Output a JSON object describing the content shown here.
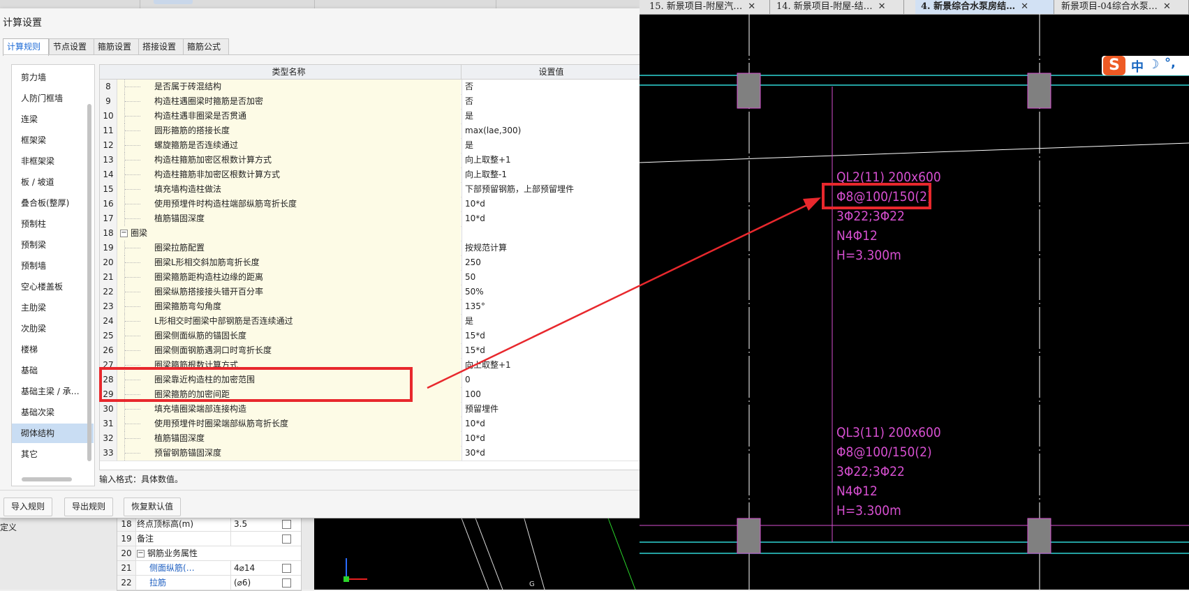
{
  "dialog": {
    "title": "计算设置",
    "tabs": [
      "计算规则",
      "节点设置",
      "箍筋设置",
      "搭接设置",
      "箍筋公式"
    ],
    "categories": [
      "剪力墙",
      "人防门框墙",
      "连梁",
      "框架梁",
      "非框架梁",
      "板 / 坡道",
      "叠合板(整厚)",
      "预制柱",
      "预制梁",
      "预制墙",
      "空心楼盖板",
      "主肋梁",
      "次肋梁",
      "楼梯",
      "基础",
      "基础主梁 / 承…",
      "基础次梁",
      "砌体结构",
      "其它"
    ],
    "selected_category": "砌体结构",
    "grid_headers": {
      "name": "类型名称",
      "value": "设置值"
    },
    "rows": [
      {
        "num": "8",
        "name": "是否属于砖混结构",
        "value": "否"
      },
      {
        "num": "9",
        "name": "构造柱遇圈梁时箍筋是否加密",
        "value": "否"
      },
      {
        "num": "10",
        "name": "构造柱遇非圈梁是否贯通",
        "value": "是"
      },
      {
        "num": "11",
        "name": "圆形箍筋的搭接长度",
        "value": "max(lae,300)"
      },
      {
        "num": "12",
        "name": "螺旋箍筋是否连续通过",
        "value": "是"
      },
      {
        "num": "13",
        "name": "构造柱箍筋加密区根数计算方式",
        "value": "向上取整+1"
      },
      {
        "num": "14",
        "name": "构造柱箍筋非加密区根数计算方式",
        "value": "向上取整-1"
      },
      {
        "num": "15",
        "name": "填充墙构造柱做法",
        "value": "下部预留钢筋，上部预留埋件"
      },
      {
        "num": "16",
        "name": "使用预埋件时构造柱端部纵筋弯折长度",
        "value": "10*d"
      },
      {
        "num": "17",
        "name": "植筋锚固深度",
        "value": "10*d"
      },
      {
        "num": "18",
        "name": "圈梁",
        "value": "",
        "group": true
      },
      {
        "num": "19",
        "name": "圈梁拉筋配置",
        "value": "按规范计算"
      },
      {
        "num": "20",
        "name": "圈梁L形相交斜加筋弯折长度",
        "value": "250"
      },
      {
        "num": "21",
        "name": "圈梁箍筋距构造柱边缘的距离",
        "value": "50"
      },
      {
        "num": "22",
        "name": "圈梁纵筋搭接接头错开百分率",
        "value": "50%"
      },
      {
        "num": "23",
        "name": "圈梁箍筋弯勾角度",
        "value": "135°"
      },
      {
        "num": "24",
        "name": "L形相交时圈梁中部钢筋是否连续通过",
        "value": "是"
      },
      {
        "num": "25",
        "name": "圈梁侧面纵筋的锚固长度",
        "value": "15*d"
      },
      {
        "num": "26",
        "name": "圈梁侧面钢筋遇洞口时弯折长度",
        "value": "15*d"
      },
      {
        "num": "27",
        "name": "圈梁箍筋根数计算方式",
        "value": "向上取整+1"
      },
      {
        "num": "28",
        "name": "圈梁靠近构造柱的加密范围",
        "value": "0"
      },
      {
        "num": "29",
        "name": "圈梁箍筋的加密间距",
        "value": "100"
      },
      {
        "num": "30",
        "name": "填充墙圈梁端部连接构造",
        "value": "预留埋件"
      },
      {
        "num": "31",
        "name": "使用预埋件时圈梁端部纵筋弯折长度",
        "value": "10*d"
      },
      {
        "num": "32",
        "name": "植筋锚固深度",
        "value": "10*d"
      },
      {
        "num": "33",
        "name": "预留钢筋锚固深度",
        "value": "30*d"
      }
    ],
    "hint": "输入格式：具体数值。",
    "buttons": [
      "导入规则",
      "导出规则",
      "恢复默认值"
    ]
  },
  "background_panel": {
    "left_label": "定义",
    "rows": [
      {
        "num": "18",
        "label": "终点顶标高(m)",
        "value": "3.5",
        "link": false
      },
      {
        "num": "19",
        "label": "备注",
        "value": "",
        "link": false
      },
      {
        "num": "20",
        "label": "钢筋业务属性",
        "value": "",
        "link": false,
        "group": true
      },
      {
        "num": "21",
        "label": "侧面纵筋(…",
        "value": "4⌀14",
        "link": true
      },
      {
        "num": "22",
        "label": "拉筋",
        "value": "(⌀6)",
        "link": true
      }
    ],
    "canvas_label": "G"
  },
  "cad": {
    "tabs": [
      {
        "label": "15. 新景项目-附屋汽…",
        "active": false
      },
      {
        "label": "14. 新景项目-附屋-结…",
        "active": false
      },
      {
        "label": "4. 新景综合水泵房结…",
        "active": true
      },
      {
        "label": "新景项目-04综合水泵…",
        "active": false
      }
    ],
    "close_glyph": "✕",
    "beam1": [
      "QL2(11) 200x600",
      "Φ8@100/150(2)",
      "3Φ22;3Φ22",
      "N4Φ12",
      "H=3.300m"
    ],
    "beam2": [
      "QL3(11) 200x600",
      "Φ8@100/150(2)",
      "3Φ22;3Φ22",
      "N4Φ12",
      "H=3.300m"
    ],
    "ime": {
      "logo": "S",
      "lang": "中",
      "moon": "☽",
      "punct": "°,"
    }
  },
  "colors": {
    "highlight": "#e8282d",
    "cad_text": "#d64fd0",
    "cad_cyan": "#2fd6d6",
    "cad_column": "#808080"
  }
}
